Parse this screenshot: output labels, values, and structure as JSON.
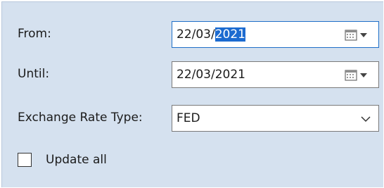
{
  "form": {
    "from": {
      "label": "From:",
      "date_prefix": "22/03/",
      "date_selected": "2021",
      "picker_icon": "calendar-icon"
    },
    "until": {
      "label": "Until:",
      "value": "22/03/2021",
      "picker_icon": "calendar-icon"
    },
    "exchange_rate_type": {
      "label": "Exchange Rate Type:",
      "value": "FED",
      "dropdown_icon": "chevron-down-icon"
    },
    "update_all": {
      "label": "Update all",
      "checked": false
    }
  },
  "colors": {
    "panel_background": "#d5e1ef",
    "selection": "#1c6bd0",
    "focus_border": "#1f6fc7"
  }
}
